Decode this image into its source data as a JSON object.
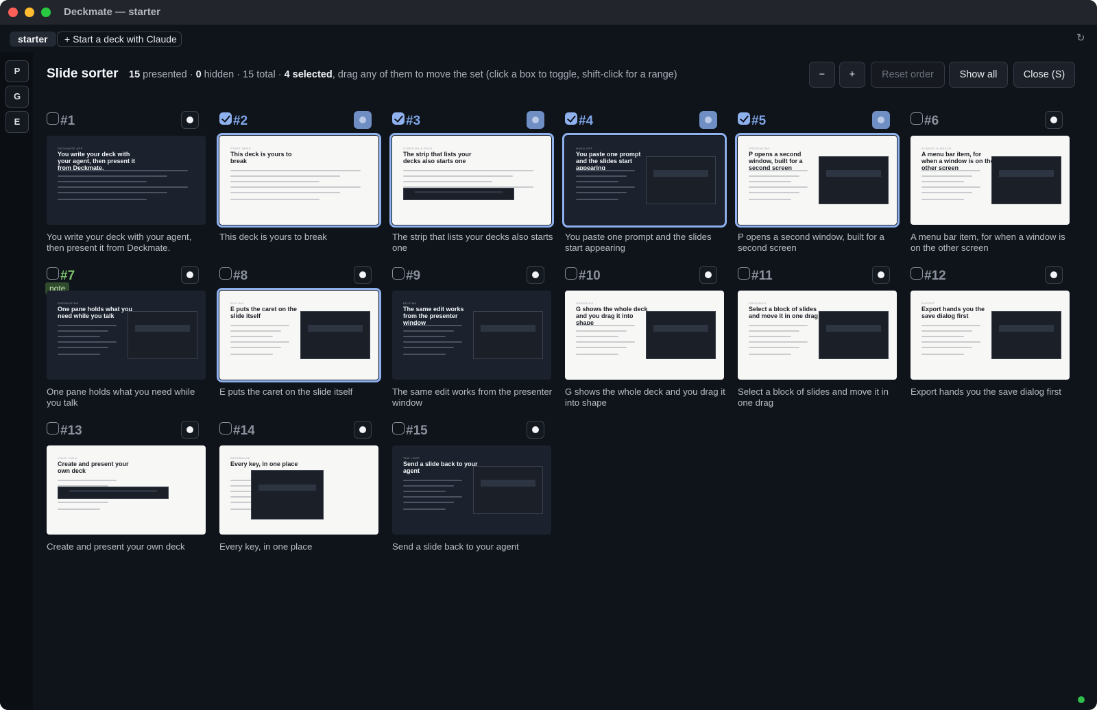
{
  "window": {
    "title": "Deckmate — starter"
  },
  "tabs": {
    "active": "starter",
    "new_label": "+ Start a deck with Claude"
  },
  "rail": [
    {
      "label": "P"
    },
    {
      "label": "G"
    },
    {
      "label": "E"
    }
  ],
  "header": {
    "title": "Slide sorter",
    "presented_count": "15",
    "presented_label": " presented · ",
    "hidden_count": "0",
    "hidden_label": " hidden · 15 total · ",
    "selected_text": "4 selected",
    "hint": ", drag any of them to move the set (click a box to toggle, shift-click for a range)"
  },
  "buttons": {
    "minus": "−",
    "plus": "+",
    "reset": "Reset order",
    "show_all": "Show all",
    "close": "Close (S)"
  },
  "slides": [
    {
      "num": "#1",
      "caption": "You write your deck with your agent, then present it from Deckmate.",
      "selected": false,
      "theme": "dark",
      "kicker": "DECKMATE APP",
      "thumb_title": "You write your deck with your agent, then present it from Deckmate."
    },
    {
      "num": "#2",
      "caption": "This deck is yours to break",
      "selected": true,
      "theme": "light",
      "kicker": "START HERE",
      "thumb_title": "This deck is yours to break"
    },
    {
      "num": "#3",
      "caption": "The strip that lists your decks also starts one",
      "selected": true,
      "theme": "light",
      "kicker": "STARTING A DECK",
      "thumb_title": "The strip that lists your decks also starts one"
    },
    {
      "num": "#4",
      "caption": "You paste one prompt and the slides start appearing",
      "selected": true,
      "theme": "dark",
      "kicker": "HAND OFF",
      "thumb_title": "You paste one prompt and the slides start appearing"
    },
    {
      "num": "#5",
      "caption": "P opens a second window, built for a second screen",
      "selected": true,
      "theme": "light",
      "kicker": "PRESENTING",
      "thumb_title": "P opens a second window, built for a second screen"
    },
    {
      "num": "#6",
      "caption": "A menu bar item, for when a window is on the other screen",
      "selected": false,
      "theme": "light",
      "kicker": "ALWAYS IN REACH",
      "thumb_title": "A menu bar item, for when a window is on the other screen"
    },
    {
      "num": "#7",
      "caption": "One pane holds what you need while you talk",
      "selected": false,
      "theme": "dark",
      "kicker": "PRESENTING",
      "thumb_title": "One pane holds what you need while you talk",
      "note": "note"
    },
    {
      "num": "#8",
      "caption": "E puts the caret on the slide itself",
      "selected": false,
      "theme": "light",
      "kicker": "EDITING",
      "thumb_title": "E puts the caret on the slide itself"
    },
    {
      "num": "#9",
      "caption": "The same edit works from the presenter window",
      "selected": false,
      "theme": "dark",
      "kicker": "EDITING",
      "thumb_title": "The same edit works from the presenter window"
    },
    {
      "num": "#10",
      "caption": "G shows the whole deck and you drag it into shape",
      "selected": false,
      "theme": "light",
      "kicker": "ORDERING",
      "thumb_title": "G shows the whole deck and you drag it into shape"
    },
    {
      "num": "#11",
      "caption": "Select a block of slides and move it in one drag",
      "selected": false,
      "theme": "light",
      "kicker": "ORDERING",
      "thumb_title": "Select a block of slides and move it in one drag"
    },
    {
      "num": "#12",
      "caption": "Export hands you the save dialog first",
      "selected": false,
      "theme": "light",
      "kicker": "EXPORT",
      "thumb_title": "Export hands you the save dialog first"
    },
    {
      "num": "#13",
      "caption": "Create and present your own deck",
      "selected": false,
      "theme": "light",
      "kicker": "YOUR TURN",
      "thumb_title": "Create and present your own deck"
    },
    {
      "num": "#14",
      "caption": "Every key, in one place",
      "selected": false,
      "theme": "light",
      "kicker": "REFERENCE",
      "thumb_title": "Every key, in one place"
    },
    {
      "num": "#15",
      "caption": "Send a slide back to your agent",
      "selected": false,
      "theme": "dark",
      "kicker": "THE LOOP",
      "thumb_title": "Send a slide back to your agent"
    }
  ]
}
